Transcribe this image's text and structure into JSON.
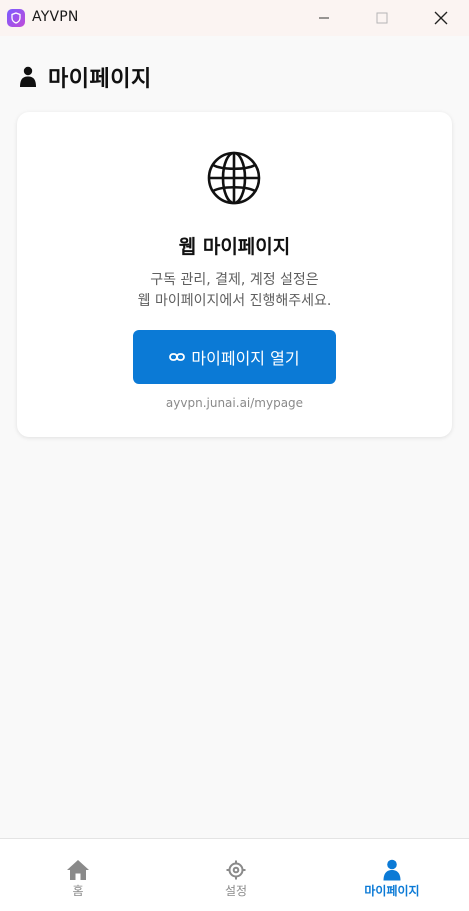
{
  "window": {
    "title": "AYVPN"
  },
  "page": {
    "title": "마이페이지"
  },
  "card": {
    "title": "웹 마이페이지",
    "description_line1": "구독 관리, 결제, 계정 설정은",
    "description_line2": "웹 마이페이지에서 진행해주세요.",
    "button_label": "마이페이지 열기",
    "url": "ayvpn.junai.ai/mypage"
  },
  "nav": {
    "items": [
      {
        "label": "홈",
        "icon": "home-icon",
        "active": false
      },
      {
        "label": "설정",
        "icon": "gear-icon",
        "active": false
      },
      {
        "label": "마이페이지",
        "icon": "person-icon",
        "active": true
      }
    ]
  },
  "colors": {
    "accent": "#0b7ad6",
    "inactive_nav": "#8a8a8a",
    "titlebar": "#fbf4f2",
    "background": "#f9f9f9"
  }
}
